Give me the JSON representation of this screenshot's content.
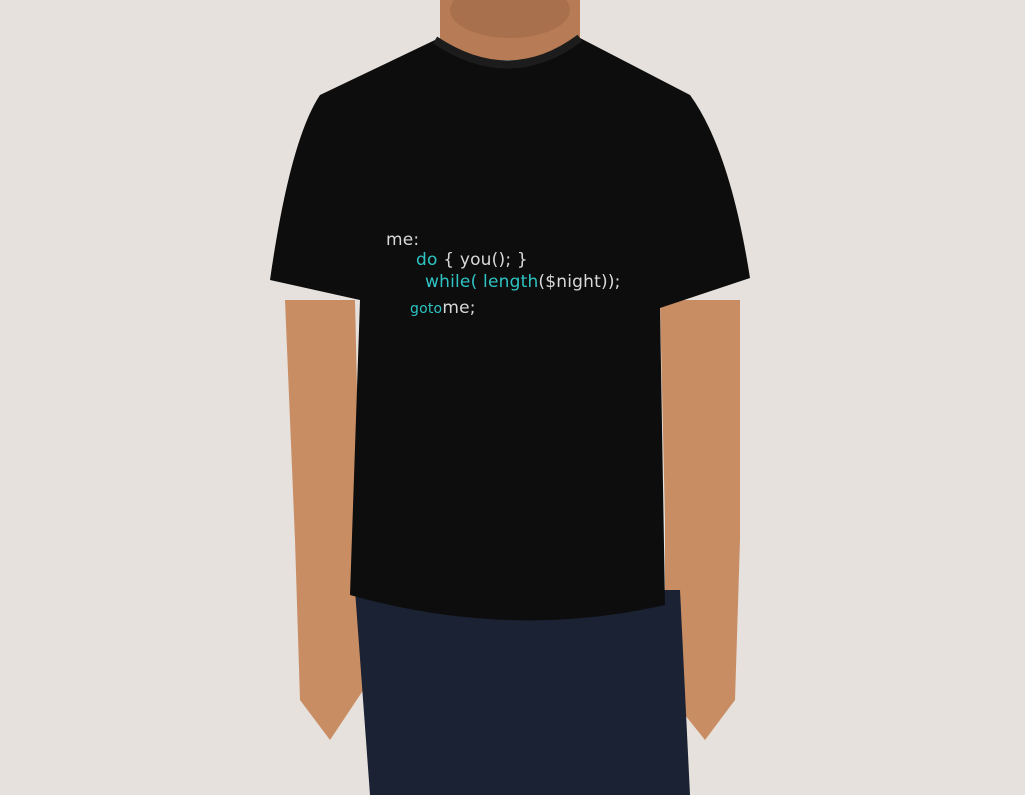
{
  "shirt_print": {
    "line1": {
      "text": "me:"
    },
    "line2": {
      "keyword": "do",
      "rest": "{ you(); }"
    },
    "line3": {
      "keyword": "while(",
      "func": "length",
      "rest": "($night));"
    },
    "line4": {
      "keyword": "goto",
      "rest": "me;"
    }
  },
  "colors": {
    "background": "#e6e1dc",
    "shirt": "#0d0d0d",
    "print_white": "#d9d9d9",
    "print_cyan": "#2ec4c4",
    "skin": "#c98d64",
    "jeans": "#1a2233"
  }
}
